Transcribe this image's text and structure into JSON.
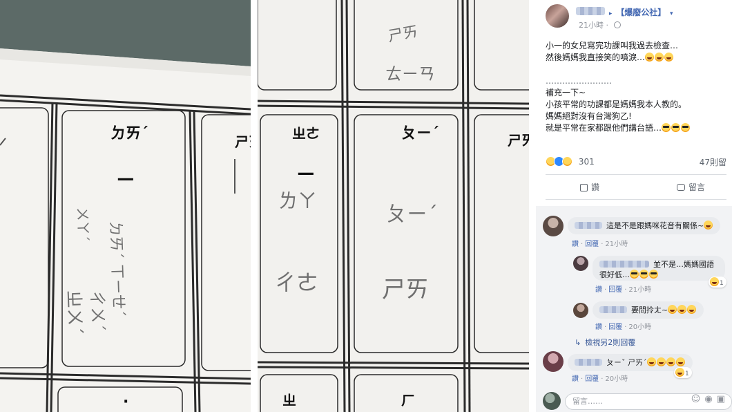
{
  "photos": {
    "left": {
      "top_symbols": [
        "ㄉㄞˊ",
        "ㄕㄞ"
      ],
      "vertical_mark": "ㄧ",
      "handwriting_main": [
        "ㄉㄞˊ ㄒㄧㄝˊ",
        "ㄔㄨˊ"
      ],
      "handwriting_side": [
        "ㄨㄚˊ",
        "ㄓㄨˊ"
      ],
      "bottom_symbol": "·"
    },
    "middle": {
      "top_symbols": [
        "ㄓㄜ",
        "ㄆㄧˊ",
        "ㄕㄞ"
      ],
      "upper_handwriting": [
        "ㄕㄞ",
        "ㄊㄧㄢ"
      ],
      "vertical_mark": "ㄧ",
      "handwriting_left": [
        "ㄌㄚ",
        "ㄔㄜ"
      ],
      "handwriting_right": [
        "ㄆㄧˊ",
        "ㄕㄞ"
      ],
      "bottom_symbols": [
        "ㄓ",
        "ㄏ"
      ]
    }
  },
  "post": {
    "page_name": "【爆廢公社】",
    "time": "21小時",
    "body_lines": [
      "小一的女兒寫完功課叫我過去檢查…",
      "然後媽媽我直接笑的噴淚…",
      "",
      "……………………",
      "補充一下~",
      "小孩平常的功課都是媽媽我本人教的。",
      "媽媽絕對沒有台灣狗乙!",
      "就是平常在家都跟他們講台語…"
    ],
    "reaction_count": "301",
    "comment_count": "47則留",
    "like_label": "讚",
    "comment_label": "留言"
  },
  "comments": [
    {
      "text": "這是不是跟媽咪花音有關係~",
      "actions": [
        "讚",
        "回覆"
      ],
      "time": "21小時"
    },
    {
      "text_line1": "並不是…媽媽國語",
      "text_line2": "很好低…",
      "actions": [
        "讚",
        "回覆"
      ],
      "time": "21小時",
      "reaction_badge": "1"
    },
    {
      "text": "要問拎ㄤ~",
      "actions": [
        "讚",
        "回覆"
      ],
      "time": "20小時"
    },
    {
      "view_more": "檢視另2則回覆"
    },
    {
      "text": "ㄆㄧˇ ㄕㄞˊ",
      "actions": [
        "讚",
        "回覆"
      ],
      "time": "20小時",
      "reaction_badge": "1"
    }
  ],
  "composer": {
    "placeholder": "留言……"
  },
  "icons": {
    "composer": [
      "emoji-icon",
      "camera-icon",
      "gif-icon",
      "sticker-icon"
    ]
  }
}
